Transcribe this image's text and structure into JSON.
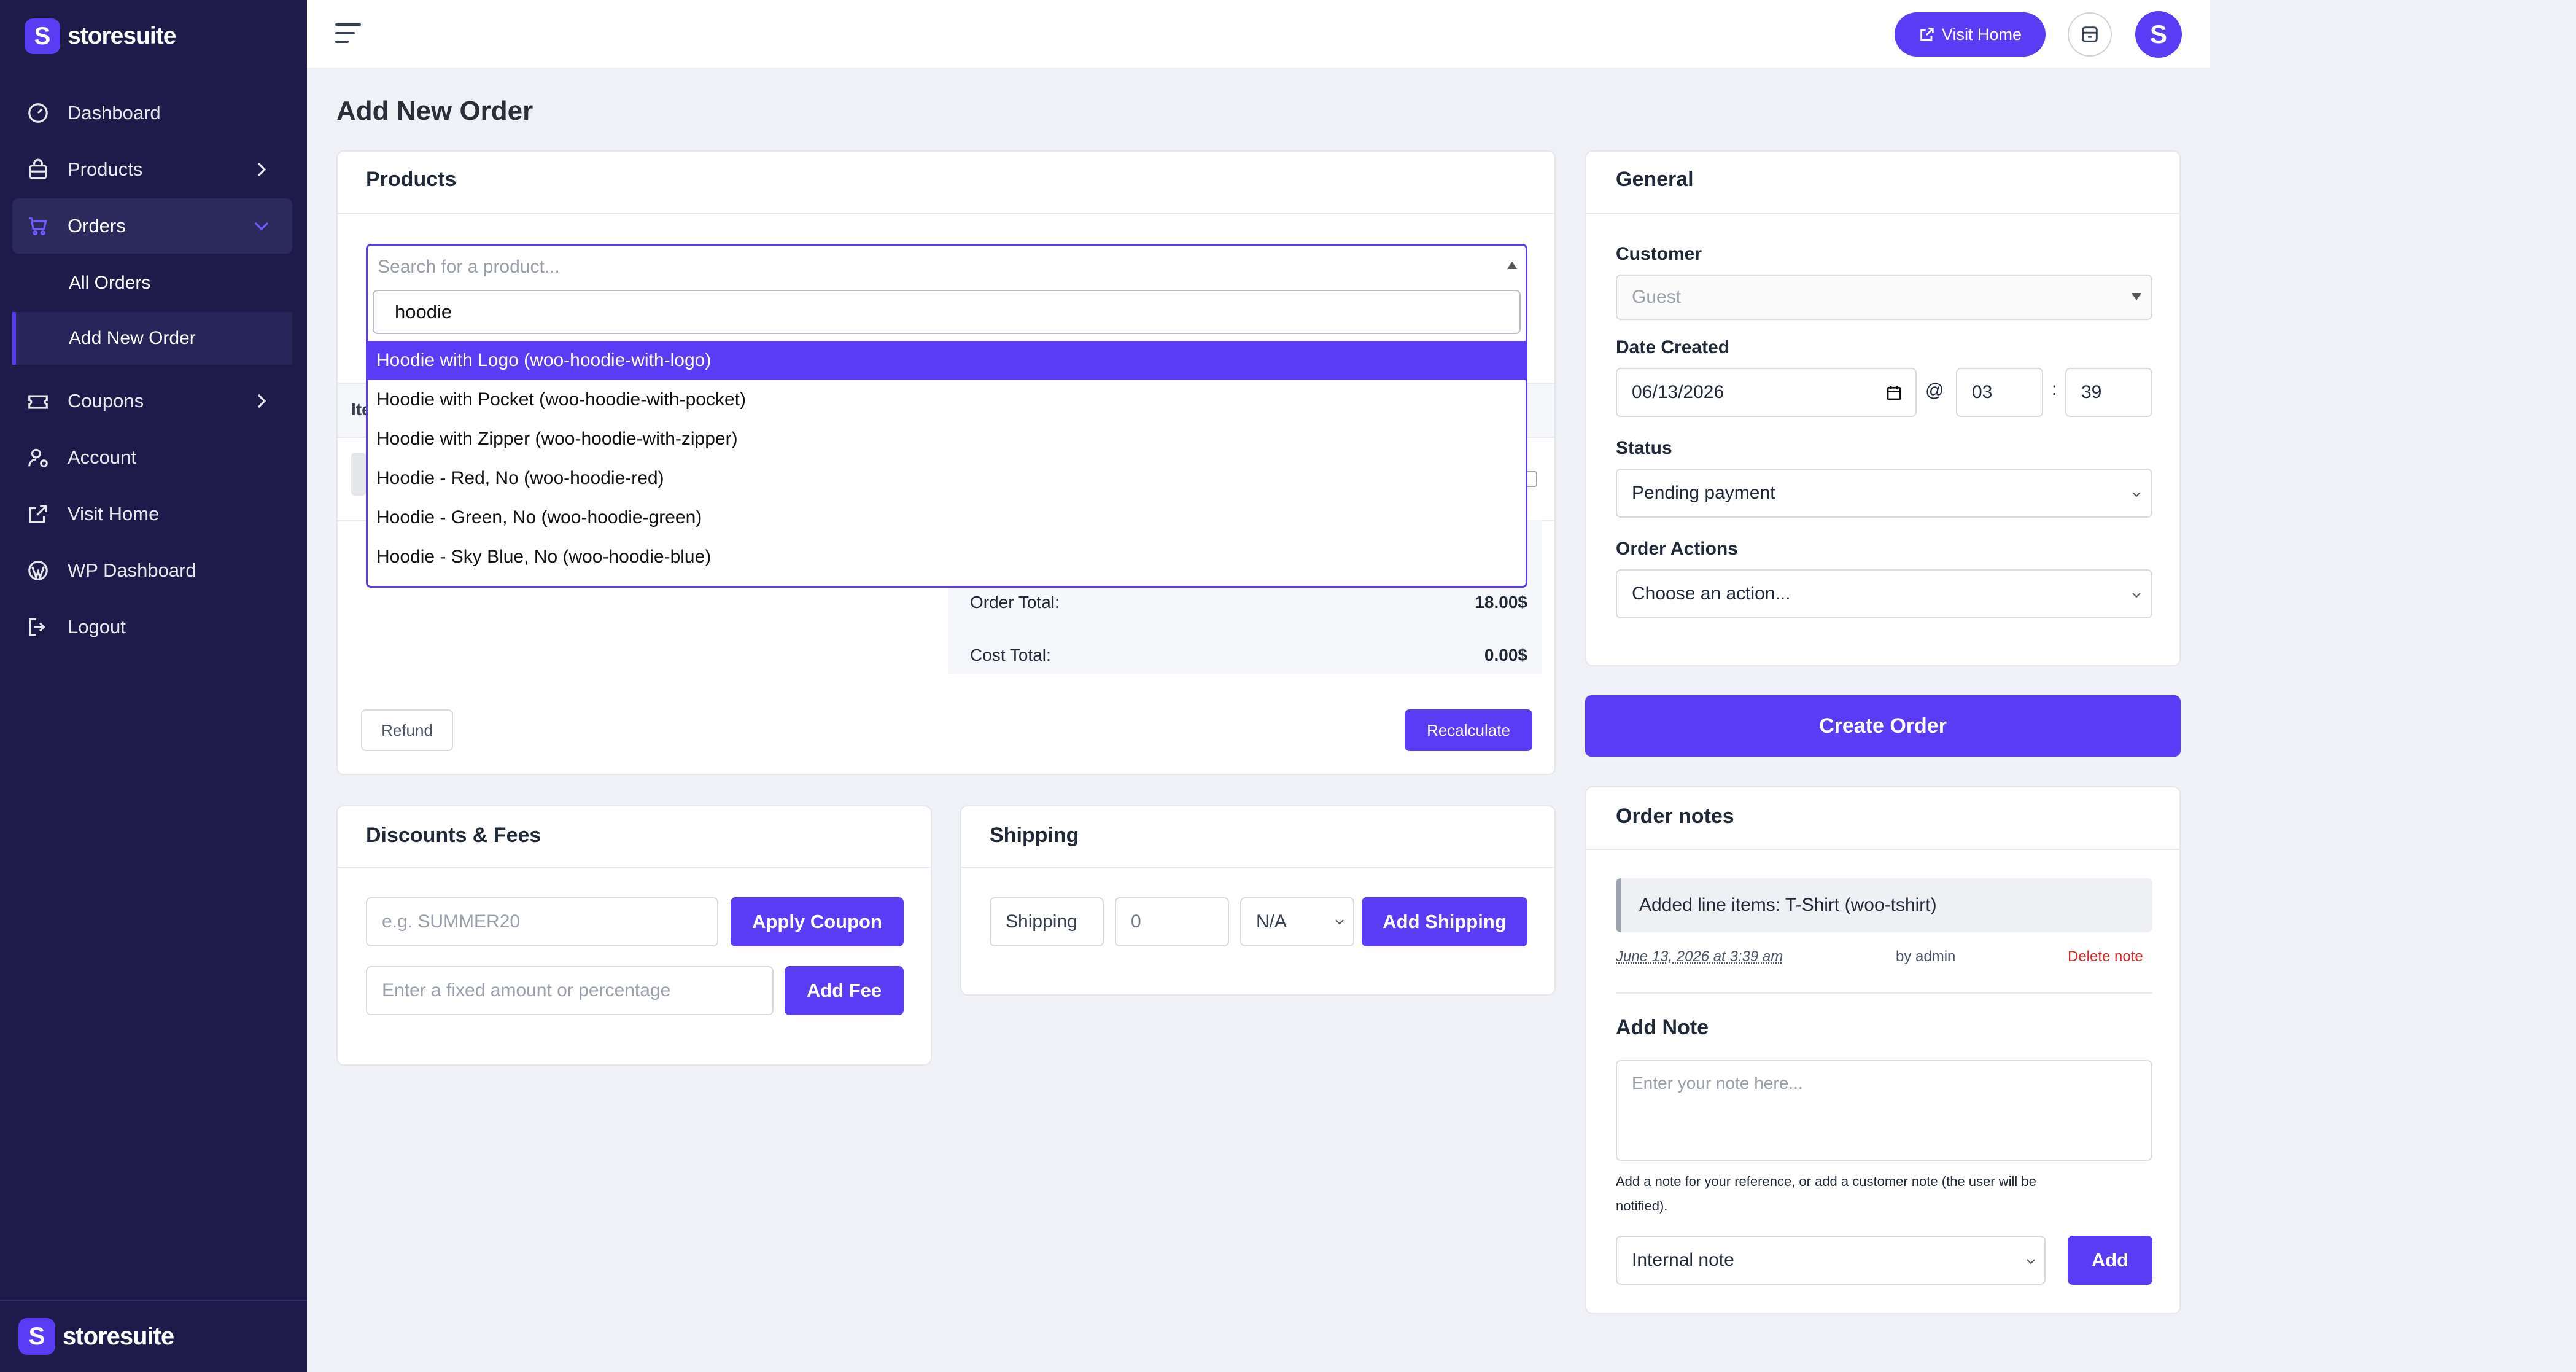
{
  "brand": {
    "name": "storesuite",
    "logo_letter": "S"
  },
  "sidebar": {
    "items": [
      {
        "label": "Dashboard",
        "icon": "gauge-icon"
      },
      {
        "label": "Products",
        "icon": "bag-icon"
      },
      {
        "label": "Orders",
        "icon": "cart-icon"
      },
      {
        "label": "Coupons",
        "icon": "ticket-icon"
      },
      {
        "label": "Account",
        "icon": "user-gear-icon"
      },
      {
        "label": "Visit Home",
        "icon": "external-link-icon"
      },
      {
        "label": "WP Dashboard",
        "icon": "wordpress-icon"
      },
      {
        "label": "Logout",
        "icon": "logout-icon"
      }
    ],
    "orders_sub": [
      {
        "label": "All Orders"
      },
      {
        "label": "Add New Order"
      }
    ]
  },
  "header": {
    "visit_home_label": "Visit Home",
    "avatar_letter": "S"
  },
  "page": {
    "title": "Add New Order"
  },
  "products": {
    "title": "Products",
    "search_placeholder": "Search for a product...",
    "search_query": "hoodie",
    "results": [
      "Hoodie with Logo (woo-hoodie-with-logo)",
      "Hoodie with Pocket (woo-hoodie-with-pocket)",
      "Hoodie with Zipper (woo-hoodie-with-zipper)",
      "Hoodie - Red, No (woo-hoodie-red)",
      "Hoodie - Green, No (woo-hoodie-green)",
      "Hoodie - Sky Blue, No (woo-hoodie-blue)"
    ],
    "partial_col_header": "Ite",
    "partial_total_symbol": "$",
    "order_total_label": "Order Total:",
    "order_total_value": "18.00$",
    "cost_total_label": "Cost Total:",
    "cost_total_value": "0.00$",
    "refund_label": "Refund",
    "recalculate_label": "Recalculate"
  },
  "discounts": {
    "title": "Discounts & Fees",
    "coupon_placeholder": "e.g. SUMMER20",
    "apply_coupon_label": "Apply Coupon",
    "fee_placeholder": "Enter a fixed amount or percentage",
    "add_fee_label": "Add Fee"
  },
  "shipping": {
    "title": "Shipping",
    "name_value": "Shipping",
    "amount_value": "0",
    "class_value": "N/A",
    "add_label": "Add Shipping"
  },
  "general": {
    "title": "General",
    "customer_label": "Customer",
    "customer_value": "Guest",
    "date_label": "Date Created",
    "date_value": "06/13/2026",
    "at_symbol": "@",
    "hour_value": "03",
    "colon": ":",
    "minute_value": "39",
    "status_label": "Status",
    "status_value": "Pending payment",
    "actions_label": "Order Actions",
    "actions_value": "Choose an action..."
  },
  "create_order_label": "Create Order",
  "notes": {
    "title": "Order notes",
    "note_text": "Added line items: T-Shirt (woo-tshirt)",
    "note_date": "June 13, 2026 at 3:39 am",
    "note_author": "by admin",
    "delete_label": "Delete note",
    "add_note_title": "Add Note",
    "note_placeholder": "Enter your note here...",
    "help_text_line1": "Add a note for your reference, or add a customer note (the user will be",
    "help_text_line2": "notified).",
    "note_type_value": "Internal note",
    "add_label": "Add"
  },
  "colors": {
    "accent": "#5b3cf5",
    "sidebar_bg": "#1e1b4b",
    "danger": "#dc2626",
    "page_bg": "#eff1f6"
  }
}
